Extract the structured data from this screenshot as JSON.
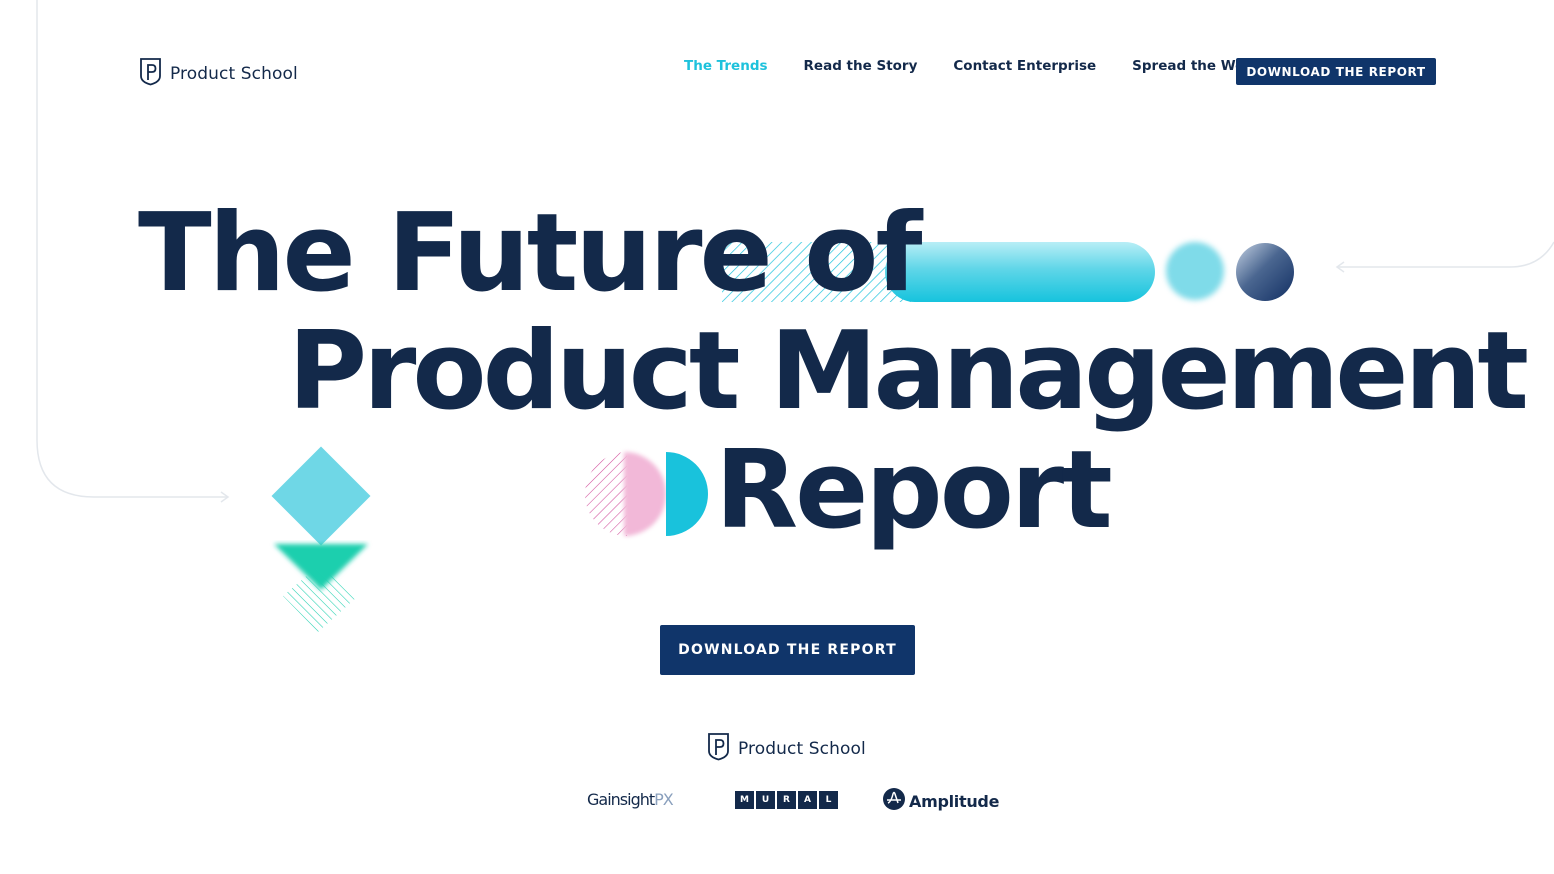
{
  "header": {
    "logo_text": "Product School",
    "nav": [
      {
        "label": "The Trends",
        "active": true
      },
      {
        "label": "Read the Story",
        "active": false
      },
      {
        "label": "Contact Enterprise",
        "active": false
      },
      {
        "label": "Spread the Word",
        "active": false
      }
    ],
    "cta_label": "DOWNLOAD THE REPORT"
  },
  "hero": {
    "line1": "The Future of",
    "line2": "Product Management",
    "line3": "Report",
    "cta_label": "DOWNLOAD THE REPORT"
  },
  "sponsors": {
    "primary_logo_text": "Product School",
    "partners": [
      {
        "name": "Gainsight PX",
        "text": "Gainsight",
        "suffix": "PX"
      },
      {
        "name": "Mural",
        "letters": [
          "M",
          "U",
          "R",
          "A",
          "L"
        ]
      },
      {
        "name": "Amplitude",
        "text": "Amplitude"
      }
    ]
  },
  "colors": {
    "navy": "#13294a",
    "button_navy": "#10356a",
    "accent_cyan": "#1ec2dc",
    "light_cyan": "#6fd7e6",
    "teal": "#1bcfae",
    "pink": "#f2b8d8"
  },
  "icons": [
    "product-school-shield-icon",
    "amplitude-logo-icon",
    "arrow-left-icon",
    "arrow-right-icon"
  ]
}
